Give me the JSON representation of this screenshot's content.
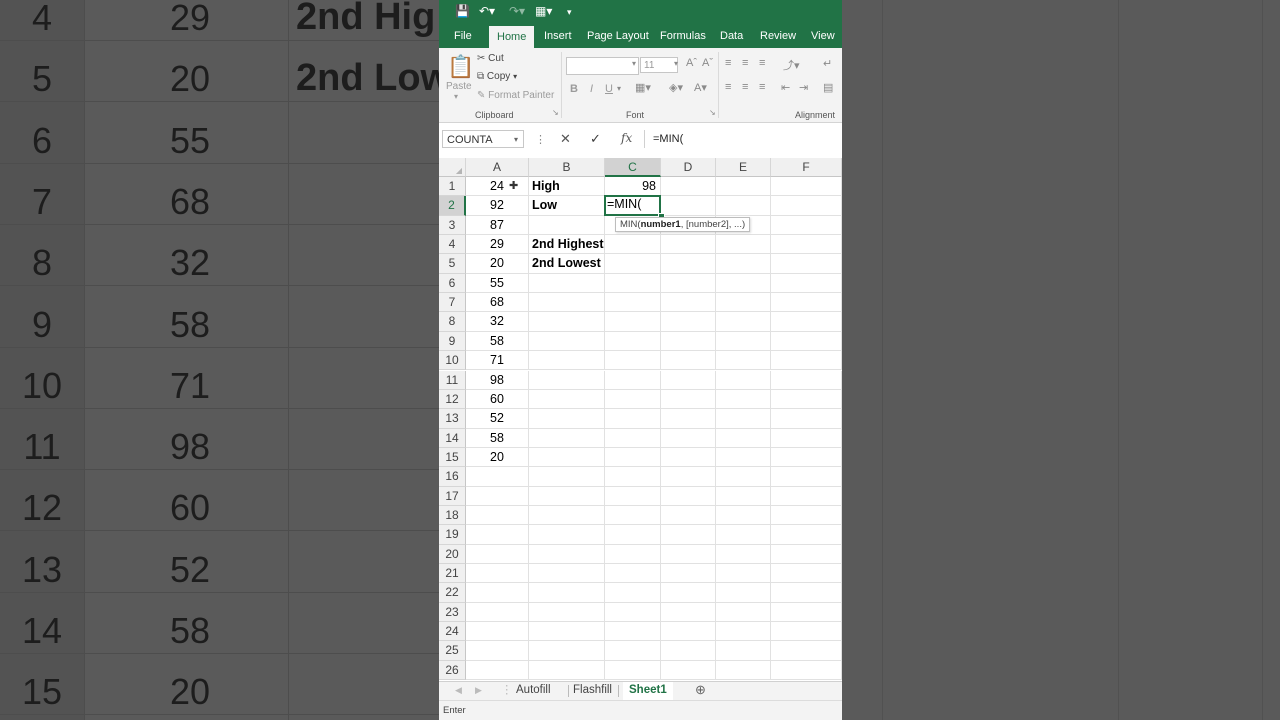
{
  "background": {
    "rows": [
      {
        "num": "4",
        "val": "29",
        "lbl": "2nd Hig"
      },
      {
        "num": "5",
        "val": "20",
        "lbl": "2nd Low"
      },
      {
        "num": "6",
        "val": "55",
        "lbl": ""
      },
      {
        "num": "7",
        "val": "68",
        "lbl": ""
      },
      {
        "num": "8",
        "val": "32",
        "lbl": ""
      },
      {
        "num": "9",
        "val": "58",
        "lbl": ""
      },
      {
        "num": "10",
        "val": "71",
        "lbl": ""
      },
      {
        "num": "11",
        "val": "98",
        "lbl": ""
      },
      {
        "num": "12",
        "val": "60",
        "lbl": ""
      },
      {
        "num": "13",
        "val": "52",
        "lbl": ""
      },
      {
        "num": "14",
        "val": "58",
        "lbl": ""
      },
      {
        "num": "15",
        "val": "20",
        "lbl": ""
      }
    ]
  },
  "ribbon": {
    "tabs": [
      "File",
      "Home",
      "Insert",
      "Page Layout",
      "Formulas",
      "Data",
      "Review",
      "View"
    ],
    "active_tab": "Home",
    "clipboard": {
      "paste": "Paste",
      "cut": "Cut",
      "copy": "Copy",
      "format_painter": "Format Painter",
      "group": "Clipboard"
    },
    "font": {
      "size": "11",
      "group": "Font",
      "bold": "B",
      "italic": "I",
      "underline": "U"
    },
    "alignment": {
      "group": "Alignment"
    }
  },
  "formula_bar": {
    "name_box": "COUNTA",
    "formula": "=MIN("
  },
  "columns": [
    "A",
    "B",
    "C",
    "D",
    "E",
    "F"
  ],
  "rows": [
    {
      "n": "1",
      "a": "24",
      "b": "High",
      "c": "98"
    },
    {
      "n": "2",
      "a": "92",
      "b": "Low",
      "c": "=MIN("
    },
    {
      "n": "3",
      "a": "87",
      "b": "",
      "c": ""
    },
    {
      "n": "4",
      "a": "29",
      "b": "2nd Highest",
      "c": ""
    },
    {
      "n": "5",
      "a": "20",
      "b": "2nd Lowest",
      "c": ""
    },
    {
      "n": "6",
      "a": "55",
      "b": "",
      "c": ""
    },
    {
      "n": "7",
      "a": "68",
      "b": "",
      "c": ""
    },
    {
      "n": "8",
      "a": "32",
      "b": "",
      "c": ""
    },
    {
      "n": "9",
      "a": "58",
      "b": "",
      "c": ""
    },
    {
      "n": "10",
      "a": "71",
      "b": "",
      "c": ""
    },
    {
      "n": "11",
      "a": "98",
      "b": "",
      "c": ""
    },
    {
      "n": "12",
      "a": "60",
      "b": "",
      "c": ""
    },
    {
      "n": "13",
      "a": "52",
      "b": "",
      "c": ""
    },
    {
      "n": "14",
      "a": "58",
      "b": "",
      "c": ""
    },
    {
      "n": "15",
      "a": "20",
      "b": "",
      "c": ""
    },
    {
      "n": "16",
      "a": "",
      "b": "",
      "c": ""
    },
    {
      "n": "17",
      "a": "",
      "b": "",
      "c": ""
    },
    {
      "n": "18",
      "a": "",
      "b": "",
      "c": ""
    },
    {
      "n": "19",
      "a": "",
      "b": "",
      "c": ""
    },
    {
      "n": "20",
      "a": "",
      "b": "",
      "c": ""
    },
    {
      "n": "21",
      "a": "",
      "b": "",
      "c": ""
    },
    {
      "n": "22",
      "a": "",
      "b": "",
      "c": ""
    },
    {
      "n": "23",
      "a": "",
      "b": "",
      "c": ""
    },
    {
      "n": "24",
      "a": "",
      "b": "",
      "c": ""
    },
    {
      "n": "25",
      "a": "",
      "b": "",
      "c": ""
    },
    {
      "n": "26",
      "a": "",
      "b": "",
      "c": ""
    }
  ],
  "tooltip": {
    "fn": "MIN(",
    "arg1": "number1",
    "rest": ", [number2], ...)"
  },
  "sheets": [
    "Autofill",
    "Flashfill",
    "Sheet1"
  ],
  "active_sheet": "Sheet1",
  "status": "Enter",
  "colors": {
    "excel_green": "#217346"
  }
}
